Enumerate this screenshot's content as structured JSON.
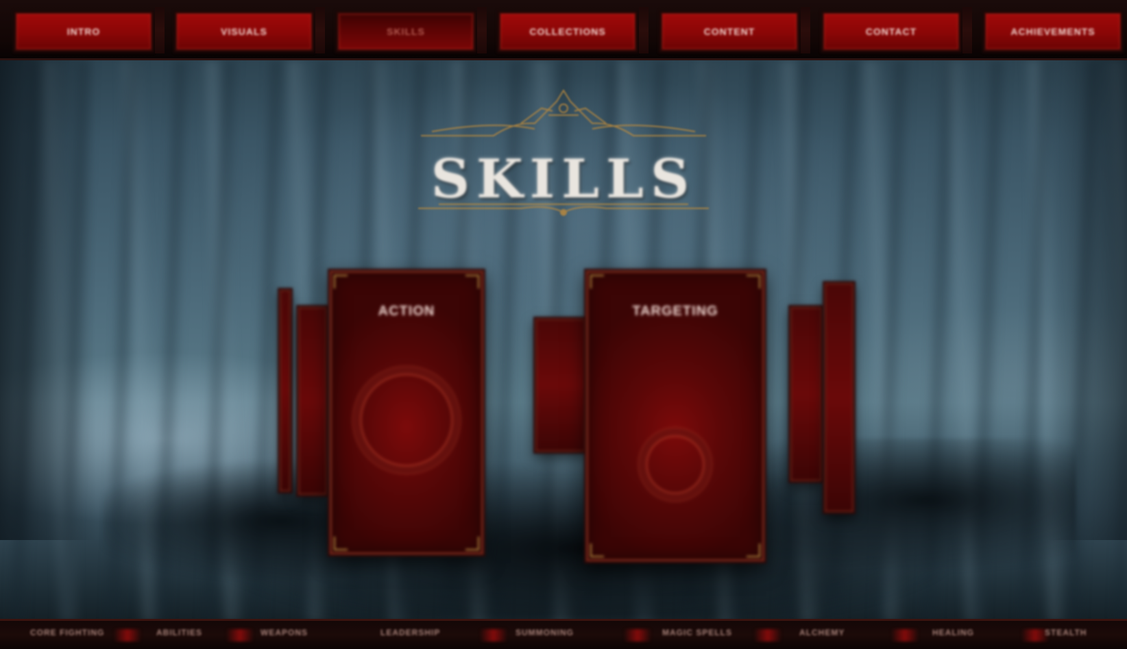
{
  "nav": {
    "items": [
      {
        "label": "Intro"
      },
      {
        "label": "Visuals"
      },
      {
        "label": "Skills"
      },
      {
        "label": "Collections"
      },
      {
        "label": "Content"
      },
      {
        "label": "Contact"
      },
      {
        "label": "Achievements"
      }
    ],
    "active_index": 2
  },
  "page": {
    "title": "SKILLS"
  },
  "cards": {
    "left_main": {
      "label": "Action"
    },
    "center_main": {
      "label": "Targeting"
    }
  },
  "bottom_bar": {
    "items": [
      {
        "label": "Core Fighting"
      },
      {
        "label": "Abilities"
      },
      {
        "label": "Weapons"
      },
      {
        "label": "Leadership"
      },
      {
        "label": "Summoning"
      },
      {
        "label": "Magic Spells"
      },
      {
        "label": "Alchemy"
      },
      {
        "label": "Healing"
      },
      {
        "label": "Stealth"
      }
    ]
  },
  "colors": {
    "accent_red": "#a00a0a",
    "gold_trim": "#b8893f",
    "title_text": "#e9e5df"
  }
}
